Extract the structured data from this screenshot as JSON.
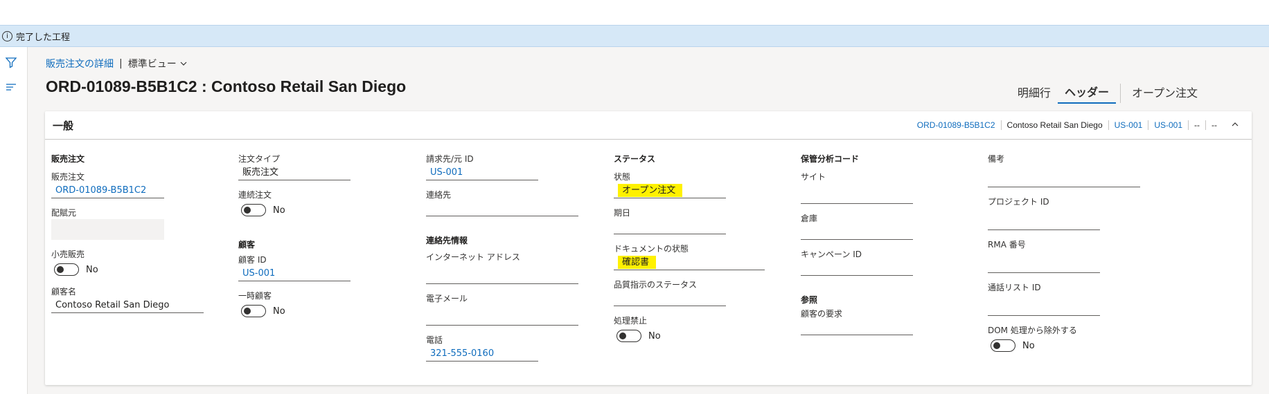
{
  "infobar": {
    "text": "完了した工程"
  },
  "breadcrumb": {
    "link": "販売注文の詳細",
    "view": "標準ビュー"
  },
  "title": "ORD-01089-B5B1C2 : Contoso Retail San Diego",
  "tabs": [
    "明細行",
    "ヘッダー",
    "オープン注文"
  ],
  "section": {
    "title": "一般",
    "summary": [
      "ORD-01089-B5B1C2",
      "Contoso Retail San Diego",
      "US-001",
      "US-001",
      "--",
      "--"
    ]
  },
  "col1": {
    "group": "販売注文",
    "order_label": "販売注文",
    "order_value": "ORD-01089-B5B1C2",
    "distributor_label": "配賦元",
    "retail_label": "小売販売",
    "retail_value": "No",
    "customer_name_label": "顧客名",
    "customer_name_value": "Contoso Retail San Diego"
  },
  "col2": {
    "order_type_label": "注文タイプ",
    "order_type_value": "販売注文",
    "continuous_label": "連続注文",
    "continuous_value": "No",
    "group": "顧客",
    "customer_id_label": "顧客 ID",
    "customer_id_value": "US-001",
    "temp_label": "一時顧客",
    "temp_value": "No"
  },
  "col3": {
    "billing_label": "請求先/元 ID",
    "billing_value": "US-001",
    "contact_label": "連絡先",
    "group": "連絡先情報",
    "internet_label": "インターネット アドレス",
    "email_label": "電子メール",
    "phone_label": "電話",
    "phone_value": "321-555-0160"
  },
  "col4": {
    "group": "ステータス",
    "state_label": "状態",
    "state_value": "オープン注文",
    "period_label": "期日",
    "doc_state_label": "ドキュメントの状態",
    "doc_state_value": "確認書",
    "quality_label": "品質指示のステータス",
    "hold_label": "処理禁止",
    "hold_value": "No"
  },
  "col5": {
    "group": "保管分析コード",
    "site_label": "サイト",
    "warehouse_label": "倉庫",
    "campaign_label": "キャンペーン ID",
    "group2": "参照",
    "customer_req_label": "顧客の要求"
  },
  "col6": {
    "notes_label": "備考",
    "project_label": "プロジェクト ID",
    "rma_label": "RMA 番号",
    "call_list_label": "通話リスト ID",
    "dom_label": "DOM 処理から除外する",
    "dom_value": "No"
  }
}
